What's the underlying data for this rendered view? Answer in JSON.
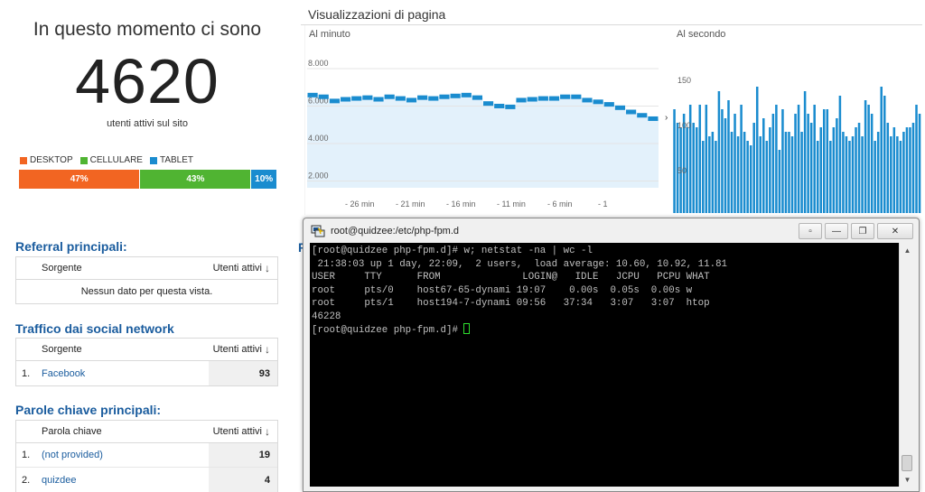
{
  "realtime": {
    "title": "In questo momento ci sono",
    "count": "4620",
    "subtitle": "utenti attivi sul sito"
  },
  "devices": {
    "legend": [
      {
        "label": "DESKTOP",
        "color": "#f26522"
      },
      {
        "label": "CELLULARE",
        "color": "#50b432"
      },
      {
        "label": "TABLET",
        "color": "#1a8ccf"
      }
    ],
    "segments": [
      {
        "label": "47%",
        "percent": 47,
        "color": "#f26522"
      },
      {
        "label": "43%",
        "percent": 43,
        "color": "#50b432"
      },
      {
        "label": "10%",
        "percent": 10,
        "color": "#1a8ccf"
      }
    ]
  },
  "referral": {
    "title": "Referral principali:",
    "col_source": "Sorgente",
    "col_users": "Utenti attivi",
    "empty_text": "Nessun dato per questa vista."
  },
  "social": {
    "title": "Traffico dai social network",
    "col_source": "Sorgente",
    "col_users": "Utenti attivi",
    "rows": [
      {
        "index": "1.",
        "name": "Facebook",
        "value": "93"
      }
    ]
  },
  "keywords": {
    "title": "Parole chiave principali:",
    "col_keyword": "Parola chiave",
    "col_users": "Utenti attivi",
    "rows": [
      {
        "index": "1.",
        "name": "(not provided)",
        "value": "19"
      },
      {
        "index": "2.",
        "name": "quizdee",
        "value": "4"
      }
    ]
  },
  "hidden_heading": "P",
  "pageviews": {
    "title": "Visualizzazioni di pagina",
    "per_minute": {
      "label": "Al minuto",
      "y_ticks": [
        "8.000",
        "6.000",
        "4.000",
        "2.000"
      ],
      "x_ticks": [
        "- 26 min",
        "- 21 min",
        "- 16 min",
        "- 11 min",
        "- 6 min",
        "- 1"
      ],
      "values": [
        7000,
        6900,
        6650,
        6750,
        6800,
        6850,
        6750,
        6900,
        6800,
        6700,
        6850,
        6800,
        6900,
        6950,
        7000,
        6850,
        6500,
        6350,
        6300,
        6700,
        6750,
        6800,
        6800,
        6900,
        6900,
        6700,
        6600,
        6450,
        6250,
        6000,
        5800,
        5600
      ],
      "color": "#1a8ccf",
      "fill": "#e3f1fb"
    },
    "per_second": {
      "label": "Al secondo",
      "y_ticks": [
        "150",
        "100",
        "50"
      ],
      "values": [
        115,
        100,
        95,
        110,
        95,
        120,
        100,
        95,
        120,
        80,
        120,
        85,
        90,
        80,
        135,
        115,
        105,
        125,
        90,
        110,
        85,
        120,
        90,
        80,
        75,
        100,
        140,
        85,
        105,
        80,
        95,
        110,
        120,
        70,
        115,
        90,
        90,
        85,
        110,
        120,
        90,
        135,
        110,
        100,
        120,
        80,
        95,
        115,
        115,
        80,
        95,
        105,
        130,
        90,
        85,
        80,
        85,
        95,
        100,
        85,
        125,
        120,
        110,
        80,
        90,
        140,
        130,
        100,
        85,
        95,
        85,
        80,
        90,
        95,
        95,
        100,
        120,
        110
      ],
      "color": "#1a8ccf"
    },
    "arrow": "›"
  },
  "terminal": {
    "title": "root@quidzee:/etc/php-fpm.d",
    "buttons": [
      "▫",
      "—",
      "❐",
      "✕"
    ],
    "lines": [
      "[root@quidzee php-fpm.d]# w; netstat -na | wc -l",
      " 21:38:03 up 1 day, 22:09,  2 users,  load average: 10.60, 10.92, 11.81",
      "USER     TTY      FROM              LOGIN@   IDLE   JCPU   PCPU WHAT",
      "root     pts/0    host67-65-dynami 19:07    0.00s  0.05s  0.00s w",
      "root     pts/1    host194-7-dynami 09:56   37:34   3:07   3:07  htop",
      "46228",
      "[root@quidzee php-fpm.d]# "
    ],
    "scroll_up": "▲",
    "scroll_down": "▼"
  }
}
